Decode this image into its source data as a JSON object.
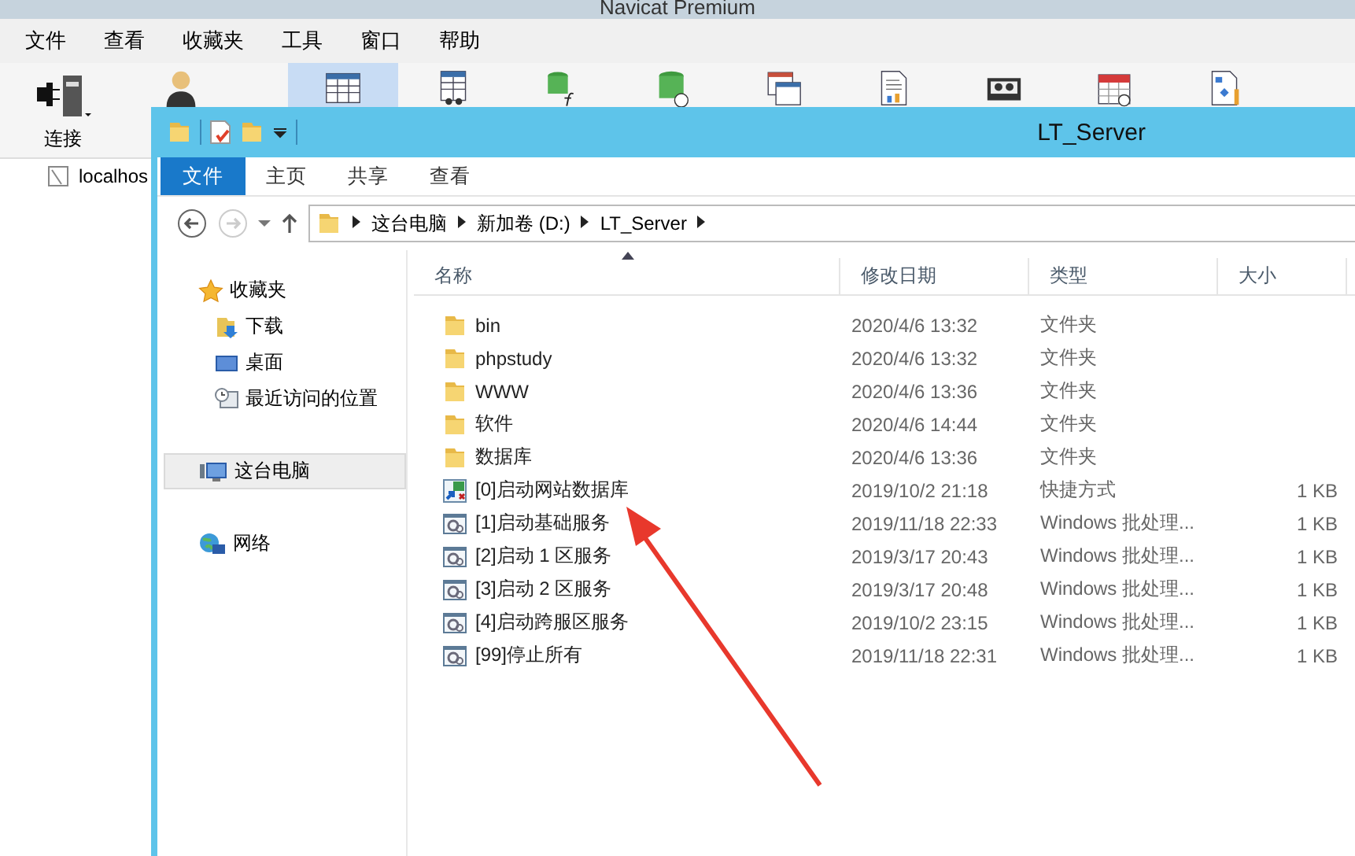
{
  "background_window": {
    "title": "Navicat Premium",
    "menu": [
      "文件",
      "查看",
      "收藏夹",
      "工具",
      "窗口",
      "帮助"
    ],
    "toolbar": [
      {
        "kind": "connect",
        "label": "连接"
      },
      {
        "kind": "user"
      },
      {
        "kind": "table",
        "selected": true
      },
      {
        "kind": "view",
        "selected": false
      },
      {
        "kind": "function",
        "selected": false
      },
      {
        "kind": "event",
        "selected": false
      },
      {
        "kind": "query",
        "selected": false
      },
      {
        "kind": "report",
        "selected": false
      },
      {
        "kind": "backup",
        "selected": false
      },
      {
        "kind": "schedule",
        "selected": false
      },
      {
        "kind": "model",
        "selected": false
      }
    ],
    "connections": [
      "localhos"
    ]
  },
  "window": {
    "title": "LT_Server",
    "ribbon_tabs": [
      {
        "label": "文件",
        "kind": "file"
      },
      {
        "label": "主页",
        "kind": "tab"
      },
      {
        "label": "共享",
        "kind": "tab"
      },
      {
        "label": "查看",
        "kind": "tab"
      }
    ],
    "nav": {
      "back_disabled": false,
      "forward_disabled": true
    },
    "path": [
      "这台电脑",
      "新加卷 (D:)",
      "LT_Server"
    ],
    "sidebar": {
      "items": [
        {
          "label": "收藏夹",
          "kind": "favorites",
          "selected": false,
          "children": [
            {
              "label": "下载",
              "kind": "downloads",
              "selected": false
            },
            {
              "label": "桌面",
              "kind": "desktop",
              "selected": false
            },
            {
              "label": "最近访问的位置",
              "kind": "recent",
              "selected": false
            }
          ]
        },
        {
          "label": "这台电脑",
          "kind": "computer",
          "selected": true
        },
        {
          "label": "网络",
          "kind": "network",
          "selected": false
        }
      ]
    },
    "table": {
      "columns": [
        "名称",
        "修改日期",
        "类型",
        "大小"
      ],
      "rows": [
        {
          "kind": "folder",
          "name": "bin",
          "date": "2020/4/6 13:32",
          "type": "文件夹"
        },
        {
          "kind": "folder",
          "name": "phpstudy",
          "date": "2020/4/6 13:32",
          "type": "文件夹"
        },
        {
          "kind": "folder",
          "name": "WWW",
          "date": "2020/4/6 13:36",
          "type": "文件夹"
        },
        {
          "kind": "folder",
          "name": "软件",
          "date": "2020/4/6 14:44",
          "type": "文件夹"
        },
        {
          "kind": "folder",
          "name": "数据库",
          "date": "2020/4/6 13:36",
          "type": "文件夹"
        },
        {
          "kind": "shortcut",
          "name": "[0]启动网站数据库",
          "date": "2019/10/2 21:18",
          "type": "快捷方式",
          "size": "1 KB"
        },
        {
          "kind": "batch",
          "name": "[1]启动基础服务",
          "date": "2019/11/18 22:33",
          "type": "Windows 批处理...",
          "size": "1 KB"
        },
        {
          "kind": "batch",
          "name": "[2]启动 1 区服务",
          "date": "2019/3/17 20:43",
          "type": "Windows 批处理...",
          "size": "1 KB"
        },
        {
          "kind": "batch",
          "name": "[3]启动 2 区服务",
          "date": "2019/3/17 20:48",
          "type": "Windows 批处理...",
          "size": "1 KB"
        },
        {
          "kind": "batch",
          "name": "[4]启动跨服区服务",
          "date": "2019/10/2 23:15",
          "type": "Windows 批处理...",
          "size": "1 KB"
        },
        {
          "kind": "batch",
          "name": "[99]停止所有",
          "date": "2019/11/18 22:31",
          "type": "Windows 批处理...",
          "size": "1 KB"
        }
      ]
    }
  }
}
